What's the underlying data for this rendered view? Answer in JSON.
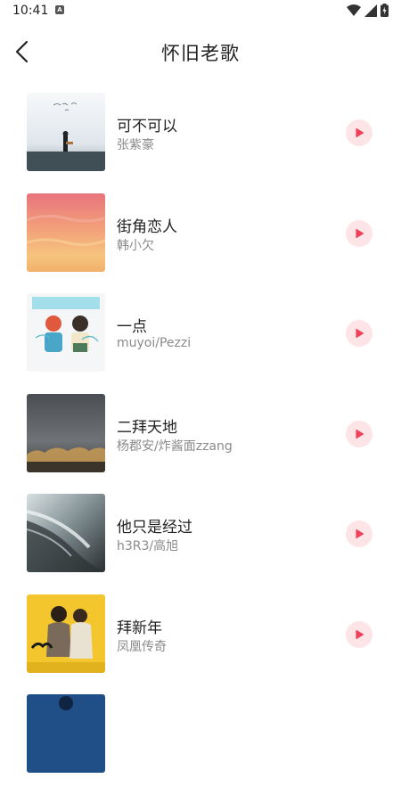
{
  "status_bar": {
    "time": "10:41",
    "notification_glyph": "A"
  },
  "header": {
    "title": "怀旧老歌"
  },
  "colors": {
    "accent": "#f0415a",
    "play_bg": "#fde4e6",
    "artist_text": "#8a8a8a"
  },
  "songs": [
    {
      "title": "可不可以",
      "artist": "张紫豪"
    },
    {
      "title": "街角恋人",
      "artist": "韩小欠"
    },
    {
      "title": "一点",
      "artist": "muyoi/Pezzi"
    },
    {
      "title": "二拜天地",
      "artist": "杨郡安/炸酱面zzang"
    },
    {
      "title": "他只是经过",
      "artist": "h3R3/高旭"
    },
    {
      "title": "拜新年",
      "artist": "凤凰传奇"
    }
  ]
}
